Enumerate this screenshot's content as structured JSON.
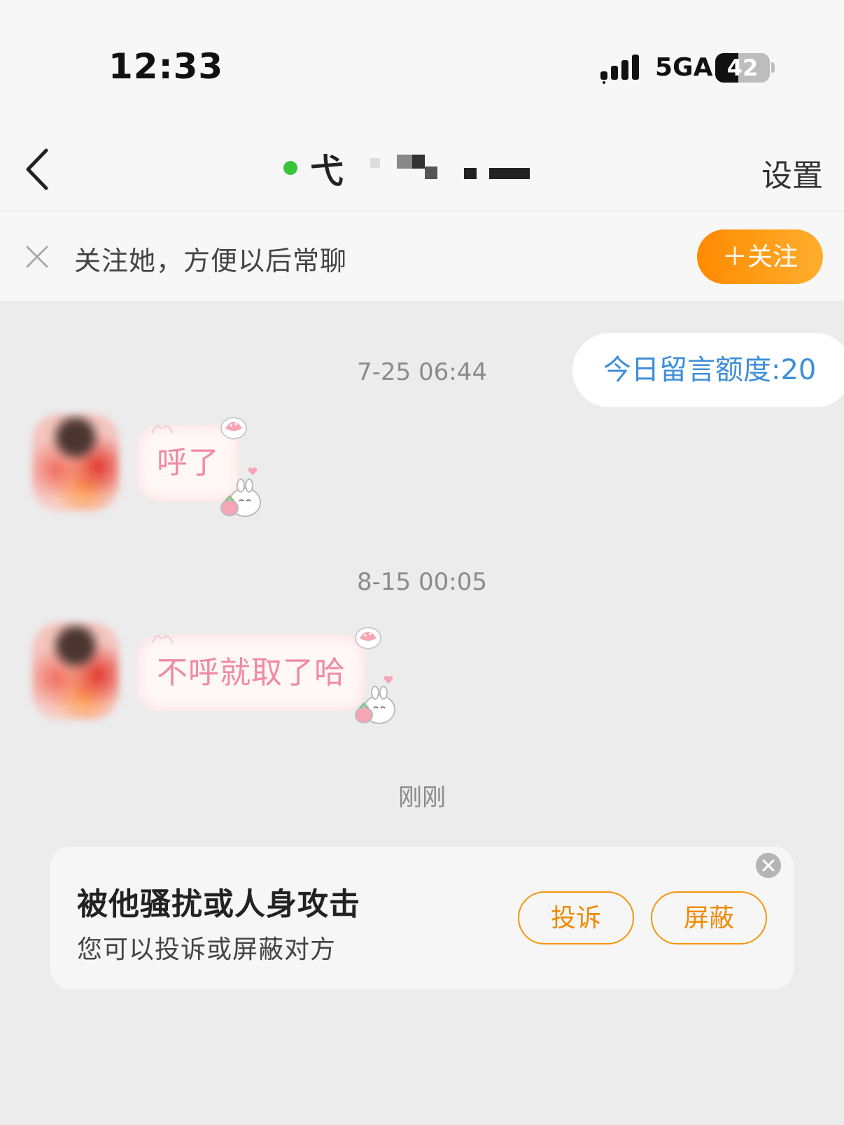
{
  "status_bar": {
    "time": "12:33",
    "network": "5GA",
    "battery": "42",
    "battery_level": 0.42
  },
  "header": {
    "back_icon": "chevron-left-icon",
    "title_visible": "弋",
    "title_obscured": true,
    "online_color": "#3bc43b",
    "settings_label": "设置"
  },
  "follow_bar": {
    "close_icon": "close-icon",
    "prompt": "关注她，方便以后常聊",
    "follow_button": "＋关注",
    "accent_color": "#ff9400"
  },
  "chat": {
    "quota": "今日留言额度:20",
    "messages": [
      {
        "timestamp": "7-25 06:44",
        "text": "呼了"
      },
      {
        "timestamp": "8-15 00:05",
        "text": "不呼就取了哈"
      }
    ],
    "recent_label": "刚刚"
  },
  "report_card": {
    "title": "被他骚扰或人身攻击",
    "subtitle": "您可以投诉或屏蔽对方",
    "complain_button": "投诉",
    "block_button": "屏蔽",
    "close_icon": "close-circle-icon",
    "accent_color": "#f5960a"
  }
}
